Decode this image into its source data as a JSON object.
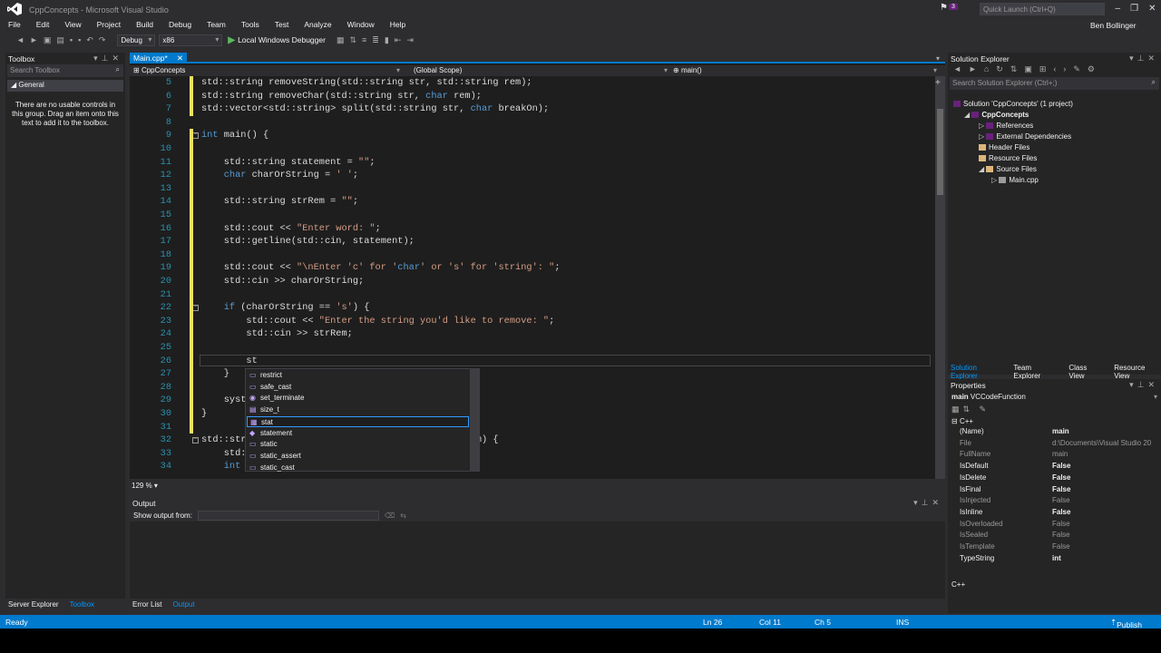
{
  "window": {
    "title": "CppConcepts - Microsoft Visual Studio",
    "quick_launch": "Quick Launch (Ctrl+Q)",
    "notification_count": "3",
    "user": "Ben Bollinger"
  },
  "menu": [
    "File",
    "Edit",
    "View",
    "Project",
    "Build",
    "Debug",
    "Team",
    "Tools",
    "Test",
    "Analyze",
    "Window",
    "Help"
  ],
  "toolbar": {
    "config": "Debug",
    "platform": "x86",
    "run": "Local Windows Debugger"
  },
  "toolbox": {
    "title": "Toolbox",
    "search": "Search Toolbox",
    "group": "General",
    "message": "There are no usable controls in this group. Drag an item onto this text to add it to the toolbox."
  },
  "left_tabs": [
    "Server Explorer",
    "Toolbox"
  ],
  "editor": {
    "tab": "Main.cpp*",
    "project": "CppConcepts",
    "scope": "(Global Scope)",
    "member": "main()",
    "zoom": "129 %"
  },
  "code_lines": [
    {
      "n": "5",
      "t": "std::string removeString(std::string str, std::string rem);"
    },
    {
      "n": "6",
      "t": "std::string removeChar(std::string str, char rem);"
    },
    {
      "n": "7",
      "t": "std::vector<std::string> split(std::string str, char breakOn);"
    },
    {
      "n": "8",
      "t": ""
    },
    {
      "n": "9",
      "t": "int main() {"
    },
    {
      "n": "10",
      "t": ""
    },
    {
      "n": "11",
      "t": "    std::string statement = \"\";"
    },
    {
      "n": "12",
      "t": "    char charOrString = ' ';"
    },
    {
      "n": "13",
      "t": ""
    },
    {
      "n": "14",
      "t": "    std::string strRem = \"\";"
    },
    {
      "n": "15",
      "t": ""
    },
    {
      "n": "16",
      "t": "    std::cout << \"Enter word: \";"
    },
    {
      "n": "17",
      "t": "    std::getline(std::cin, statement);"
    },
    {
      "n": "18",
      "t": ""
    },
    {
      "n": "19",
      "t": "    std::cout << \"\\nEnter 'c' for 'char' or 's' for 'string': \";"
    },
    {
      "n": "20",
      "t": "    std::cin >> charOrString;"
    },
    {
      "n": "21",
      "t": ""
    },
    {
      "n": "22",
      "t": "    if (charOrString == 's') {"
    },
    {
      "n": "23",
      "t": "        std::cout << \"Enter the string you'd like to remove: \";"
    },
    {
      "n": "24",
      "t": "        std::cin >> strRem;"
    },
    {
      "n": "25",
      "t": ""
    },
    {
      "n": "26",
      "t": "        st"
    },
    {
      "n": "27",
      "t": "    }"
    },
    {
      "n": "28",
      "t": ""
    },
    {
      "n": "29",
      "t": "    syst"
    },
    {
      "n": "30",
      "t": "}"
    },
    {
      "n": "31",
      "t": ""
    },
    {
      "n": "32",
      "t": "std::str                                   ing rem) {"
    },
    {
      "n": "33",
      "t": "    std:"
    },
    {
      "n": "34",
      "t": "    int"
    }
  ],
  "autocomplete": [
    {
      "label": "restrict",
      "icon": "keyword-icon"
    },
    {
      "label": "safe_cast",
      "icon": "keyword-icon"
    },
    {
      "label": "set_terminate",
      "icon": "function-icon"
    },
    {
      "label": "size_t",
      "icon": "typedef-icon"
    },
    {
      "label": "stat",
      "icon": "struct-icon"
    },
    {
      "label": "statement",
      "icon": "variable-icon"
    },
    {
      "label": "static",
      "icon": "keyword-icon"
    },
    {
      "label": "static_assert",
      "icon": "keyword-icon"
    },
    {
      "label": "static_cast",
      "icon": "keyword-icon"
    }
  ],
  "output": {
    "title": "Output",
    "show_from": "Show output from:"
  },
  "bottom_tabs": [
    "Error List",
    "Output"
  ],
  "solution_explorer": {
    "title": "Solution Explorer",
    "search": "Search Solution Explorer (Ctrl+;)",
    "tree": [
      {
        "label": "Solution 'CppConcepts' (1 project)",
        "depth": 0
      },
      {
        "label": "CppConcepts",
        "depth": 1
      },
      {
        "label": "References",
        "depth": 2
      },
      {
        "label": "External Dependencies",
        "depth": 2
      },
      {
        "label": "Header Files",
        "depth": 2
      },
      {
        "label": "Resource Files",
        "depth": 2
      },
      {
        "label": "Source Files",
        "depth": 2
      },
      {
        "label": "Main.cpp",
        "depth": 3
      }
    ],
    "tabs": [
      "Solution Explorer",
      "Team Explorer",
      "Class View",
      "Resource View"
    ]
  },
  "properties": {
    "title": "Properties",
    "object": "main",
    "object_type": "VCCodeFunction",
    "category": "C++",
    "footer": "C++",
    "rows": [
      {
        "k": "(Name)",
        "v": "main",
        "dim": false
      },
      {
        "k": "File",
        "v": "d:\\Documents\\Visual Studio 20",
        "dim": true
      },
      {
        "k": "FullName",
        "v": "main",
        "dim": true
      },
      {
        "k": "IsDefault",
        "v": "False",
        "dim": false
      },
      {
        "k": "IsDelete",
        "v": "False",
        "dim": false
      },
      {
        "k": "IsFinal",
        "v": "False",
        "dim": false
      },
      {
        "k": "IsInjected",
        "v": "False",
        "dim": true
      },
      {
        "k": "IsInline",
        "v": "False",
        "dim": false
      },
      {
        "k": "IsOverloaded",
        "v": "False",
        "dim": true
      },
      {
        "k": "IsSealed",
        "v": "False",
        "dim": true
      },
      {
        "k": "IsTemplate",
        "v": "False",
        "dim": true
      },
      {
        "k": "TypeString",
        "v": "int",
        "dim": false
      }
    ]
  },
  "status": {
    "ready": "Ready",
    "ln": "Ln 26",
    "col": "Col 11",
    "ch": "Ch 5",
    "mode": "INS",
    "publish": "Publish"
  },
  "colors": {
    "accent": "#007acc",
    "background": "#2d2d30",
    "editor": "#1e1e1e",
    "keyword": "#569cd6",
    "string": "#d69d85",
    "line_number": "#2b91af"
  }
}
